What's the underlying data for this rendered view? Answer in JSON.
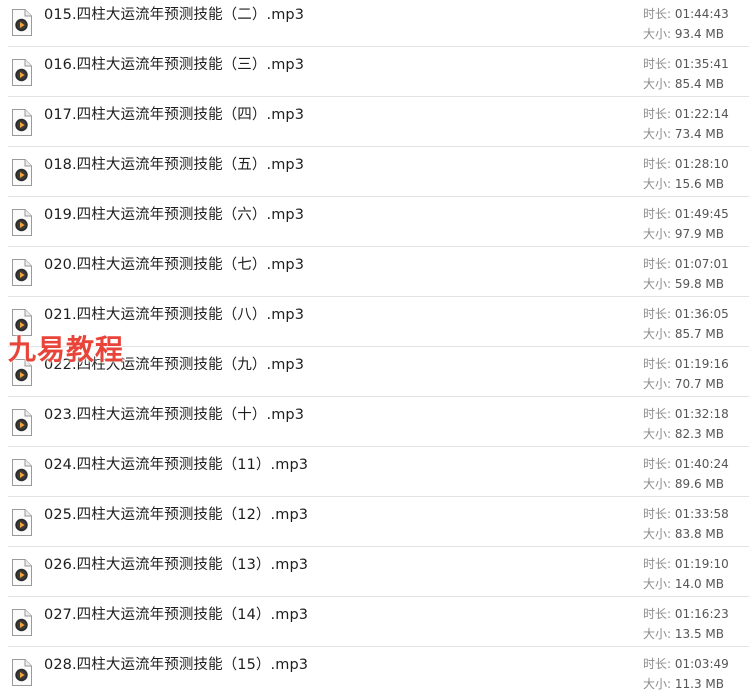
{
  "files": [
    {
      "name": "015.四柱大运流年预测技能（二）.mp3",
      "duration_label": "时长: ",
      "duration": "01:44:43",
      "size_label": "大小: ",
      "size": "93.4 MB"
    },
    {
      "name": "016.四柱大运流年预测技能（三）.mp3",
      "duration_label": "时长: ",
      "duration": "01:35:41",
      "size_label": "大小: ",
      "size": "85.4 MB"
    },
    {
      "name": "017.四柱大运流年预测技能（四）.mp3",
      "duration_label": "时长: ",
      "duration": "01:22:14",
      "size_label": "大小: ",
      "size": "73.4 MB"
    },
    {
      "name": "018.四柱大运流年预测技能（五）.mp3",
      "duration_label": "时长: ",
      "duration": "01:28:10",
      "size_label": "大小: ",
      "size": "15.6 MB"
    },
    {
      "name": "019.四柱大运流年预测技能（六）.mp3",
      "duration_label": "时长: ",
      "duration": "01:49:45",
      "size_label": "大小: ",
      "size": "97.9 MB"
    },
    {
      "name": "020.四柱大运流年预测技能（七）.mp3",
      "duration_label": "时长: ",
      "duration": "01:07:01",
      "size_label": "大小: ",
      "size": "59.8 MB"
    },
    {
      "name": "021.四柱大运流年预测技能（八）.mp3",
      "duration_label": "时长: ",
      "duration": "01:36:05",
      "size_label": "大小: ",
      "size": "85.7 MB"
    },
    {
      "name": "022.四柱大运流年预测技能（九）.mp3",
      "duration_label": "时长: ",
      "duration": "01:19:16",
      "size_label": "大小: ",
      "size": "70.7 MB"
    },
    {
      "name": "023.四柱大运流年预测技能（十）.mp3",
      "duration_label": "时长: ",
      "duration": "01:32:18",
      "size_label": "大小: ",
      "size": "82.3 MB"
    },
    {
      "name": "024.四柱大运流年预测技能（11）.mp3",
      "duration_label": "时长: ",
      "duration": "01:40:24",
      "size_label": "大小: ",
      "size": "89.6 MB"
    },
    {
      "name": "025.四柱大运流年预测技能（12）.mp3",
      "duration_label": "时长: ",
      "duration": "01:33:58",
      "size_label": "大小: ",
      "size": "83.8 MB"
    },
    {
      "name": "026.四柱大运流年预测技能（13）.mp3",
      "duration_label": "时长: ",
      "duration": "01:19:10",
      "size_label": "大小: ",
      "size": "14.0 MB"
    },
    {
      "name": "027.四柱大运流年预测技能（14）.mp3",
      "duration_label": "时长: ",
      "duration": "01:16:23",
      "size_label": "大小: ",
      "size": "13.5 MB"
    },
    {
      "name": "028.四柱大运流年预测技能（15）.mp3",
      "duration_label": "时长: ",
      "duration": "01:03:49",
      "size_label": "大小: ",
      "size": "11.3 MB"
    }
  ],
  "icon": "audio-file-icon",
  "watermark": "九易教程",
  "colors": {
    "watermark": "#e8443a",
    "divider": "#e3e3e3",
    "meta_label": "#8c8c8c",
    "meta_value": "#555555"
  }
}
